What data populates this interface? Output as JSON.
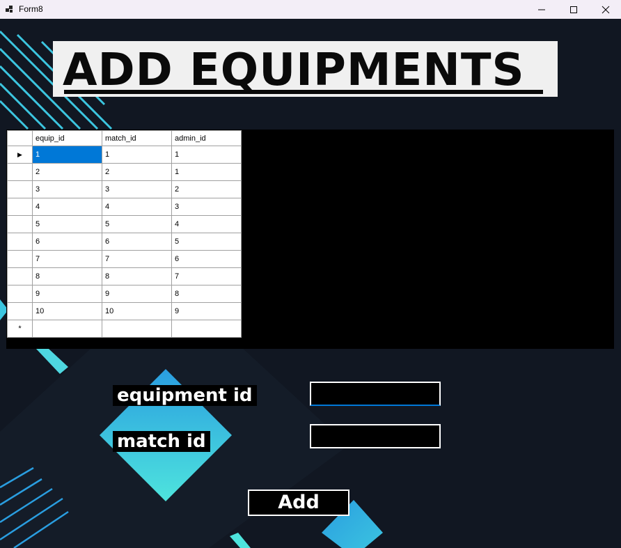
{
  "window": {
    "title": "Form8",
    "controls": {
      "minimize": "—",
      "maximize": "☐",
      "close": "✕"
    }
  },
  "heading": "ADD EQUIPMENTS",
  "grid": {
    "columns": [
      "equip_id",
      "match_id",
      "admin_id"
    ],
    "rows": [
      [
        "1",
        "1",
        "1"
      ],
      [
        "2",
        "2",
        "1"
      ],
      [
        "3",
        "3",
        "2"
      ],
      [
        "4",
        "4",
        "3"
      ],
      [
        "5",
        "5",
        "4"
      ],
      [
        "6",
        "6",
        "5"
      ],
      [
        "7",
        "7",
        "6"
      ],
      [
        "8",
        "8",
        "7"
      ],
      [
        "9",
        "9",
        "8"
      ],
      [
        "10",
        "10",
        "9"
      ]
    ],
    "current_row_marker": "▶",
    "new_row_marker": "*"
  },
  "form": {
    "equipment_id_label": "equipment id",
    "equipment_id_value": "",
    "match_id_label": "match id",
    "match_id_value": "",
    "add_button": "Add"
  },
  "colors": {
    "background": "#111722",
    "accent_cyan": "#4ee4dd",
    "accent_blue": "#2a9ee0",
    "selection": "#0078d7"
  }
}
